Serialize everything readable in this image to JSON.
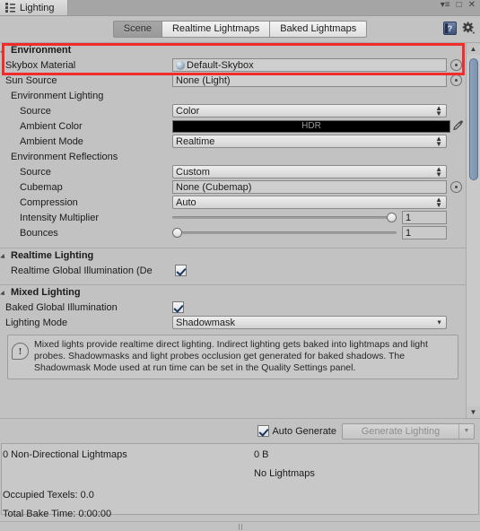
{
  "window": {
    "tab_title": "Lighting",
    "tab_icon": "lighting-window-icon",
    "menu_icon": "window-menu-icon",
    "maximize_icon": "maximize-icon",
    "close_icon": "close-icon"
  },
  "toolbar": {
    "tabs": [
      {
        "label": "Scene",
        "selected": true
      },
      {
        "label": "Realtime Lightmaps",
        "selected": false
      },
      {
        "label": "Baked Lightmaps",
        "selected": false
      }
    ],
    "help_icon": "help-book-icon",
    "help_glyph": "?",
    "settings_icon": "gear-icon"
  },
  "environment": {
    "header": "Environment",
    "highlighted": true,
    "highlight_color": "#f22b2b",
    "skybox_material": {
      "label": "Skybox Material",
      "value": "Default-Skybox",
      "thumb": "material-sphere-icon"
    },
    "sun_source": {
      "label": "Sun Source",
      "value": "None (Light)"
    },
    "environment_lighting": {
      "group_label": "Environment Lighting",
      "source": {
        "label": "Source",
        "value": "Color"
      },
      "ambient_color": {
        "label": "Ambient Color",
        "value": "HDR",
        "swatch": "#000000",
        "eyedropper": "eyedropper-icon"
      },
      "ambient_mode": {
        "label": "Ambient Mode",
        "value": "Realtime"
      }
    },
    "environment_reflections": {
      "group_label": "Environment Reflections",
      "source": {
        "label": "Source",
        "value": "Custom"
      },
      "cubemap": {
        "label": "Cubemap",
        "value": "None (Cubemap)"
      },
      "compression": {
        "label": "Compression",
        "value": "Auto"
      },
      "intensity_multiplier": {
        "label": "Intensity Multiplier",
        "value": "1",
        "knob_pct": 100
      },
      "bounces": {
        "label": "Bounces",
        "value": "1",
        "knob_pct": 0
      }
    }
  },
  "realtime_lighting": {
    "header": "Realtime Lighting",
    "realtime_gi": {
      "label": "Realtime Global Illumination (De",
      "checked": true
    }
  },
  "mixed_lighting": {
    "header": "Mixed Lighting",
    "baked_gi": {
      "label": "Baked Global Illumination",
      "checked": true
    },
    "lighting_mode": {
      "label": "Lighting Mode",
      "value": "Shadowmask"
    },
    "help": {
      "icon": "info-icon",
      "glyph": "!",
      "text": "Mixed lights provide realtime direct lighting. Indirect lighting gets baked into lightmaps and light probes. Shadowmasks and light probes occlusion get generated for baked shadows. The Shadowmask Mode used at run time can be set in the Quality Settings panel."
    }
  },
  "bottom_bar": {
    "auto_generate": {
      "label": "Auto Generate",
      "checked": true
    },
    "generate_lighting": {
      "label": "Generate Lighting",
      "enabled": false,
      "dropdown_icon": "chevron-down-icon"
    }
  },
  "stats": {
    "lightmaps_count": "0 Non-Directional Lightmaps",
    "size": "0 B",
    "lightmaps_state": "No Lightmaps",
    "occupied_texels": "Occupied Texels: 0.0",
    "total_bake_time": "Total Bake Time: 0:00:00"
  },
  "scrollbar": {
    "up_arrow": "▲",
    "down_arrow": "▼"
  }
}
